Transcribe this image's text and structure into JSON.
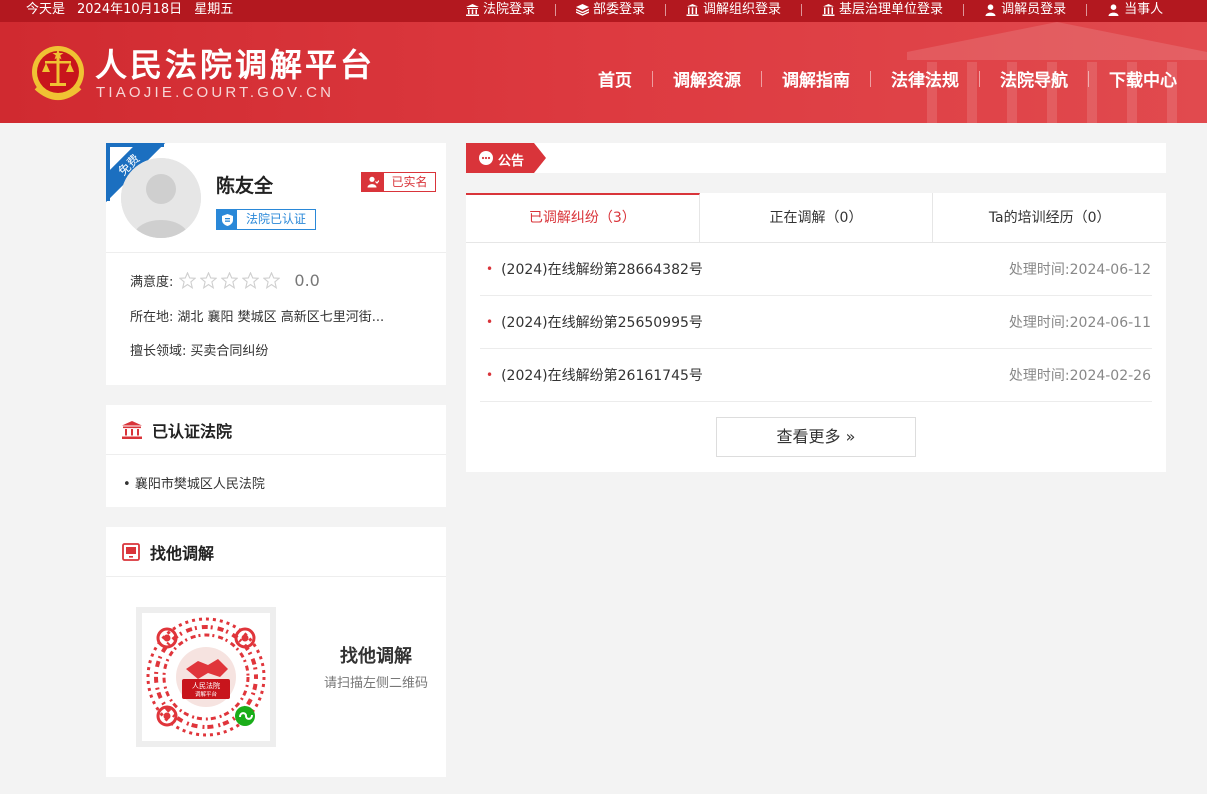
{
  "topbar": {
    "date_prefix": "今天是",
    "date": "2024年10月18日",
    "weekday": "星期五",
    "links": [
      {
        "label": "法院登录",
        "icon": "court-icon"
      },
      {
        "label": "部委登录",
        "icon": "layers-icon"
      },
      {
        "label": "调解组织登录",
        "icon": "building-icon"
      },
      {
        "label": "基层治理单位登录",
        "icon": "building-icon"
      },
      {
        "label": "调解员登录",
        "icon": "user-icon"
      },
      {
        "label": "当事人",
        "icon": "user-icon"
      }
    ]
  },
  "header": {
    "title": "人民法院调解平台",
    "subtitle": "TIAOJIE.COURT.GOV.CN",
    "nav": [
      "首页",
      "调解资源",
      "调解指南",
      "法律法规",
      "法院导航",
      "下载中心"
    ]
  },
  "profile": {
    "ribbon": "免费",
    "name": "陈友全",
    "real_name_badge": "已实名",
    "court_certified_badge": "法院已认证",
    "satisfaction_label": "满意度:",
    "satisfaction_stars": 0,
    "satisfaction_score": "0.0",
    "location_label": "所在地:",
    "location": "湖北 襄阳 樊城区 高新区七里河街...",
    "expertise_label": "擅长领域:",
    "expertise": "买卖合同纠纷"
  },
  "courts": {
    "title": "已认证法院",
    "items": [
      "襄阳市樊城区人民法院"
    ]
  },
  "find": {
    "title": "找他调解",
    "qr_caption_title": "找他调解",
    "qr_caption_sub": "请扫描左侧二维码",
    "qr_logo_text_1": "人民法院",
    "qr_logo_text_2": "调解平台"
  },
  "notice": {
    "label": "公告"
  },
  "tabs": [
    {
      "label": "已调解纠纷（3）",
      "active": true
    },
    {
      "label": "正在调解（0）",
      "active": false
    },
    {
      "label": "Ta的培训经历（0）",
      "active": false
    }
  ],
  "cases": [
    {
      "id": "(2024)在线解纷第28664382号",
      "time_label": "处理时间:",
      "time": "2024-06-12"
    },
    {
      "id": "(2024)在线解纷第25650995号",
      "time_label": "处理时间:",
      "time": "2024-06-11"
    },
    {
      "id": "(2024)在线解纷第26161745号",
      "time_label": "处理时间:",
      "time": "2024-02-26"
    }
  ],
  "more_button": "查看更多 »",
  "colors": {
    "brand_red": "#d9343a",
    "topbar_red": "#b3181f",
    "cert_blue": "#2a88d8",
    "ribbon_blue": "#1b6fc0"
  }
}
